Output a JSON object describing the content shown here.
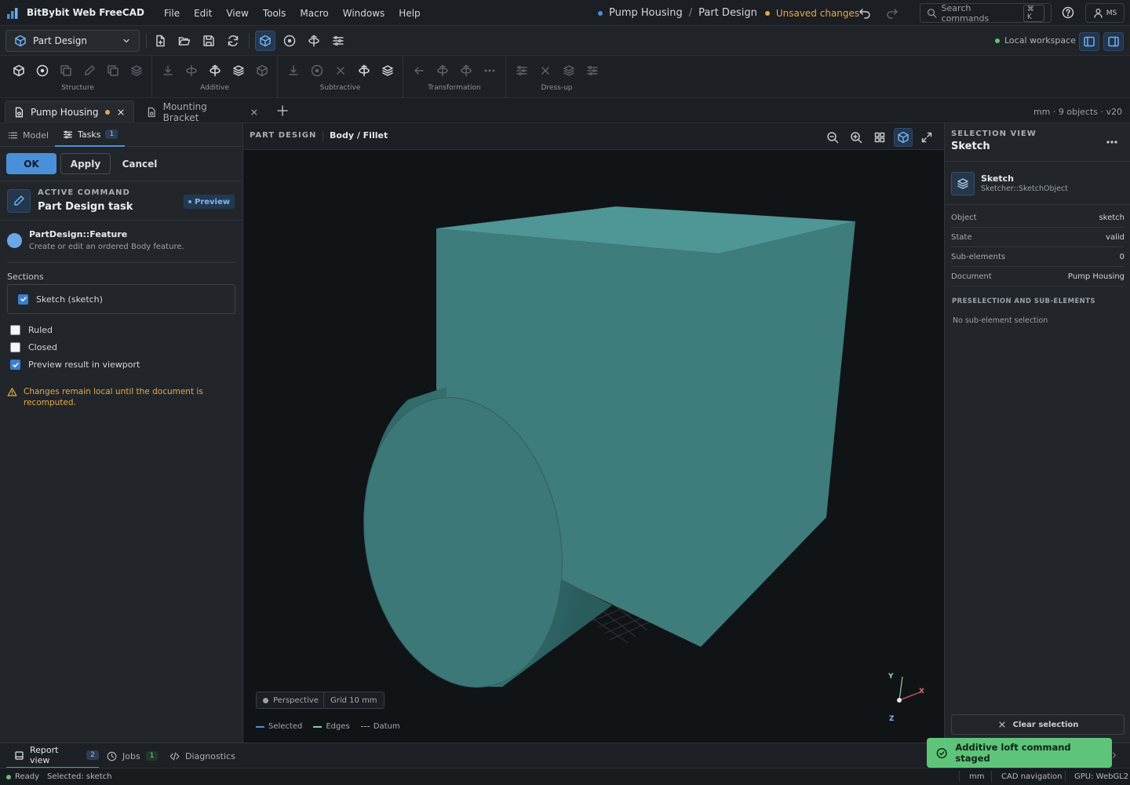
{
  "app": {
    "name": "BitBybit Web FreeCAD"
  },
  "menu": [
    "File",
    "Edit",
    "View",
    "Tools",
    "Macro",
    "Windows",
    "Help"
  ],
  "header": {
    "document": "Pump Housing",
    "separator": "/",
    "workbench": "Part Design",
    "unsaved": "Unsaved changes",
    "search_placeholder": "Search commands",
    "search_shortcut": "⌘ K",
    "user_initials": "MS"
  },
  "toolbar": {
    "workbench_select": "Part Design",
    "workspace": "Local workspace"
  },
  "ribbon": {
    "groups": [
      "Structure",
      "Additive",
      "Subtractive",
      "Transformation",
      "Dress-up"
    ]
  },
  "doc_tabs": [
    {
      "label": "Pump Housing",
      "modified": true
    },
    {
      "label": "Mounting Bracket",
      "modified": false
    }
  ],
  "doc_info": "mm · 9 objects · v20",
  "left_panel": {
    "tabs": [
      {
        "label": "Model"
      },
      {
        "label": "Tasks",
        "badge": "1"
      }
    ],
    "buttons": {
      "ok": "OK",
      "apply": "Apply",
      "cancel": "Cancel"
    },
    "active_command": {
      "caption": "ACTIVE COMMAND",
      "title": "Part Design task",
      "badge": "Preview"
    },
    "feature": {
      "name": "PartDesign::Feature",
      "description": "Create or edit an ordered Body feature."
    },
    "sections_label": "Sections",
    "section_item": {
      "label": "Sketch (sketch)",
      "checked": true
    },
    "options": [
      {
        "label": "Ruled",
        "checked": false
      },
      {
        "label": "Closed",
        "checked": false
      },
      {
        "label": "Preview result in viewport",
        "checked": true
      }
    ],
    "warning": "Changes remain local until the document is recomputed."
  },
  "viewport": {
    "caption": "PART DESIGN",
    "path": "Body / Fillet",
    "chips": {
      "projection": "Perspective",
      "grid": "Grid 10 mm"
    },
    "legend": [
      "Selected",
      "Edges",
      "Datum"
    ],
    "axes": {
      "x": "X",
      "y": "Y",
      "z": "Z"
    }
  },
  "selection_view": {
    "caption": "SELECTION VIEW",
    "title": "Sketch",
    "object_name": "Sketch",
    "object_type": "Sketcher::SketchObject",
    "properties": [
      {
        "key": "Object",
        "value": "sketch"
      },
      {
        "key": "State",
        "value": "valid"
      },
      {
        "key": "Sub-elements",
        "value": "0"
      },
      {
        "key": "Document",
        "value": "Pump Housing"
      }
    ],
    "preselection_caption": "PRESELECTION AND SUB-ELEMENTS",
    "preselection_empty": "No sub-element selection",
    "clear_button": "Clear selection"
  },
  "bottom_tabs": [
    {
      "label": "Report view",
      "badge": "2"
    },
    {
      "label": "Jobs",
      "badge": "1"
    },
    {
      "label": "Diagnostics"
    }
  ],
  "status": {
    "state": "Ready",
    "selected": "Selected: sketch",
    "units": "mm",
    "navigation": "CAD navigation",
    "gpu": "GPU: WebGL2"
  },
  "toast": "Additive loft command staged",
  "colors": {
    "accent": "#4a90d9",
    "model_face": "#3f7c7c",
    "model_top": "#4f9696",
    "warning": "#e4a94a",
    "success": "#5ec47a"
  }
}
